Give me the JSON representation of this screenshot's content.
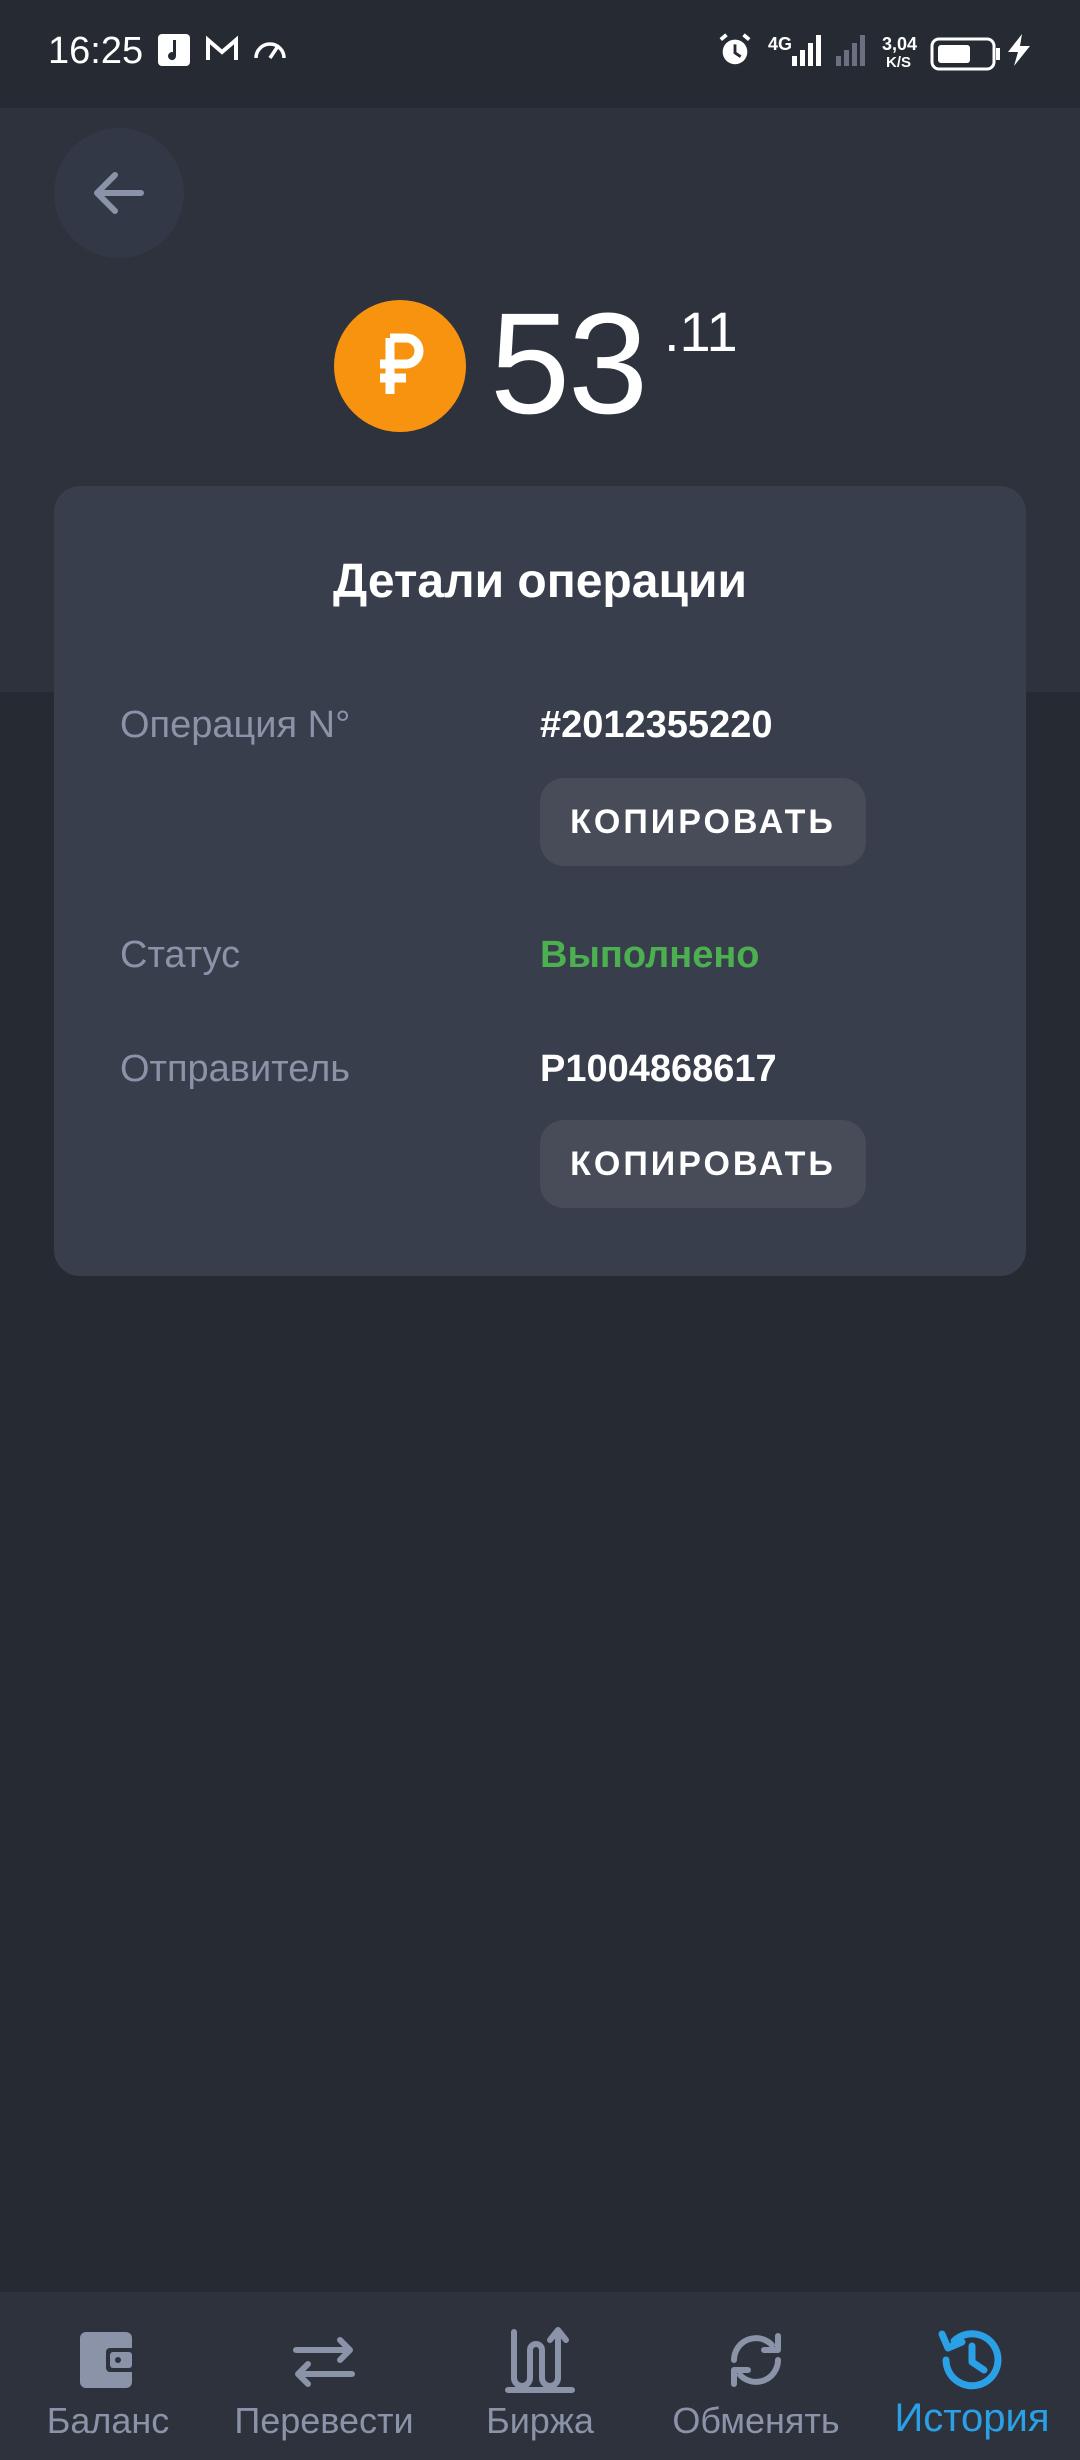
{
  "status_bar": {
    "time": "16:25",
    "network": "4G",
    "speed_value": "3,04",
    "speed_unit": "K/S"
  },
  "header": {
    "back_icon": "arrow-left-icon",
    "currency_icon": "ruble-coin-icon",
    "amount_integer": "53",
    "amount_fraction": ".11",
    "coin_color": "#f7930f"
  },
  "details": {
    "title": "Детали операции",
    "operation_label": "Операция N°",
    "operation_value": "#2012355220",
    "copy_label": "КОПИРОВАТЬ",
    "status_label": "Статус",
    "status_value": "Выполнено",
    "status_color": "#4caf50",
    "sender_label": "Отправитель",
    "sender_value": "P1004868617"
  },
  "nav": {
    "items": [
      {
        "label": "Баланс",
        "icon": "wallet-icon"
      },
      {
        "label": "Перевести",
        "icon": "transfer-arrows-icon"
      },
      {
        "label": "Биржа",
        "icon": "exchange-chart-icon"
      },
      {
        "label": "Обменять",
        "icon": "refresh-icon"
      },
      {
        "label": "История",
        "icon": "history-icon",
        "active": true
      }
    ],
    "active_color": "#2aa1e6"
  }
}
